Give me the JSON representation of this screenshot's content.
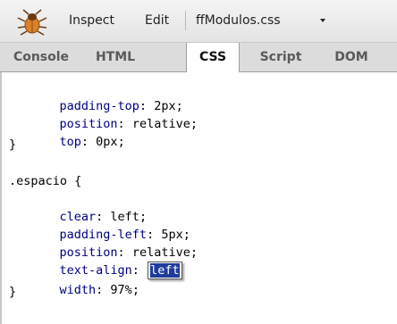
{
  "toolbar": {
    "inspect_label": "Inspect",
    "edit_label": "Edit",
    "file_label": "ffModulos.css"
  },
  "tabs": [
    {
      "label": "Console"
    },
    {
      "label": "HTML"
    },
    {
      "label": "CSS"
    },
    {
      "label": "Script"
    },
    {
      "label": "DOM"
    }
  ],
  "active_tab": "CSS",
  "css": {
    "rule1": {
      "decls": [
        {
          "prop": "padding-top",
          "value": "2px"
        },
        {
          "prop": "position",
          "value": "relative"
        },
        {
          "prop": "top",
          "value": "0px"
        }
      ],
      "close": "}"
    },
    "rule2": {
      "selector": ".espacio {",
      "decls": [
        {
          "prop": "clear",
          "value": "left"
        },
        {
          "prop": "padding-left",
          "value": "5px"
        },
        {
          "prop": "position",
          "value": "relative"
        },
        {
          "prop": "text-align",
          "value": "left"
        },
        {
          "prop": "width",
          "value": "97%"
        }
      ],
      "close": "}"
    }
  },
  "colors": {
    "property": "#000080",
    "selection": "#1f3c9c"
  }
}
